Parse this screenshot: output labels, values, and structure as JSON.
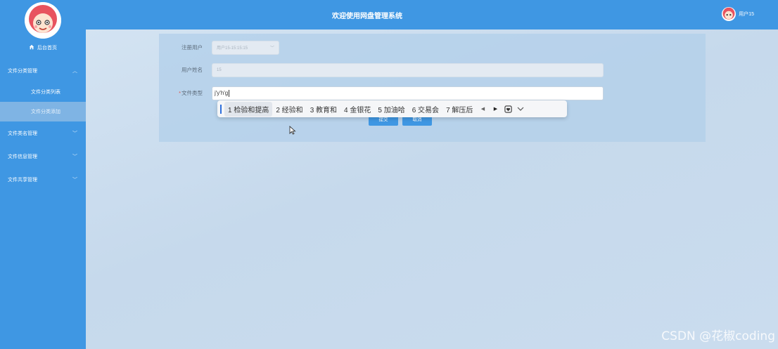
{
  "header": {
    "title": "欢迎使用网盘管理系统",
    "username": "用户15"
  },
  "sidebar": {
    "home_label": "后台首页",
    "groups": [
      {
        "label": "文件分类管理",
        "items": [
          {
            "label": "文件分类列表"
          },
          {
            "label": "文件分类添加",
            "active": true
          }
        ]
      },
      {
        "label": "文件类名管理"
      },
      {
        "label": "文件信息管理"
      },
      {
        "label": "文件共享管理"
      }
    ]
  },
  "form": {
    "reg_user_label": "注册用户",
    "reg_user_value": "用户15-15:15:15",
    "user_name_label": "用户姓名",
    "user_name_value": "15",
    "file_type_label": "文件类型",
    "file_type_required": "*",
    "file_type_value": "j'y'h'g",
    "submit_label": "提交",
    "cancel_label": "取消"
  },
  "ime": {
    "candidates": [
      "1 检验和提高",
      "2 经验和",
      "3 教育和",
      "4 金银花",
      "5 加油哈",
      "6 交易会",
      "7 解压后"
    ],
    "selected_index": 0
  },
  "watermark": "CSDN @花椒coding",
  "colors": {
    "primary": "#3f97e3",
    "active_item": "#7fb4e4",
    "background": "#c9dcee"
  }
}
